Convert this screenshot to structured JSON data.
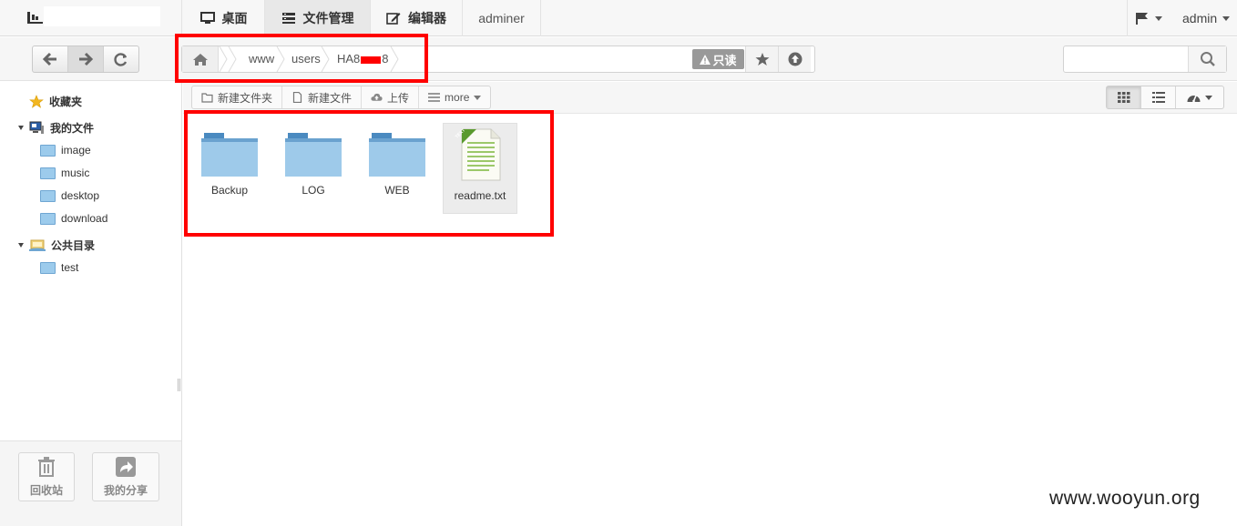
{
  "topbar": {
    "nav": [
      {
        "label": "桌面",
        "icon": "monitor-icon"
      },
      {
        "label": "文件管理",
        "icon": "file-manager-icon",
        "active": true
      },
      {
        "label": "编辑器",
        "icon": "edit-icon"
      },
      {
        "label": "adminer"
      }
    ],
    "flag_icon": "flag-icon",
    "user_label": "admin"
  },
  "breadcrumb": {
    "items": [
      "www",
      "users",
      "HA8",
      "8"
    ],
    "readonly_label": "只读"
  },
  "sidebar": {
    "favorites": "收藏夹",
    "my_files": "我的文件",
    "my_folders": [
      "image",
      "music",
      "desktop",
      "download"
    ],
    "public": "公共目录",
    "public_folders": [
      "test"
    ],
    "recycle": "回收站",
    "share": "我的分享"
  },
  "toolbar": {
    "new_folder": "新建文件夹",
    "new_file": "新建文件",
    "upload": "上传",
    "more": "more"
  },
  "files": [
    {
      "name": "Backup",
      "type": "folder"
    },
    {
      "name": "LOG",
      "type": "folder"
    },
    {
      "name": "WEB",
      "type": "folder"
    },
    {
      "name": "readme.txt",
      "type": "text",
      "badge": "TEXT"
    }
  ],
  "watermark": "www.wooyun.org",
  "colors": {
    "highlight": "#ff0000",
    "folder": "#9ecaea"
  }
}
